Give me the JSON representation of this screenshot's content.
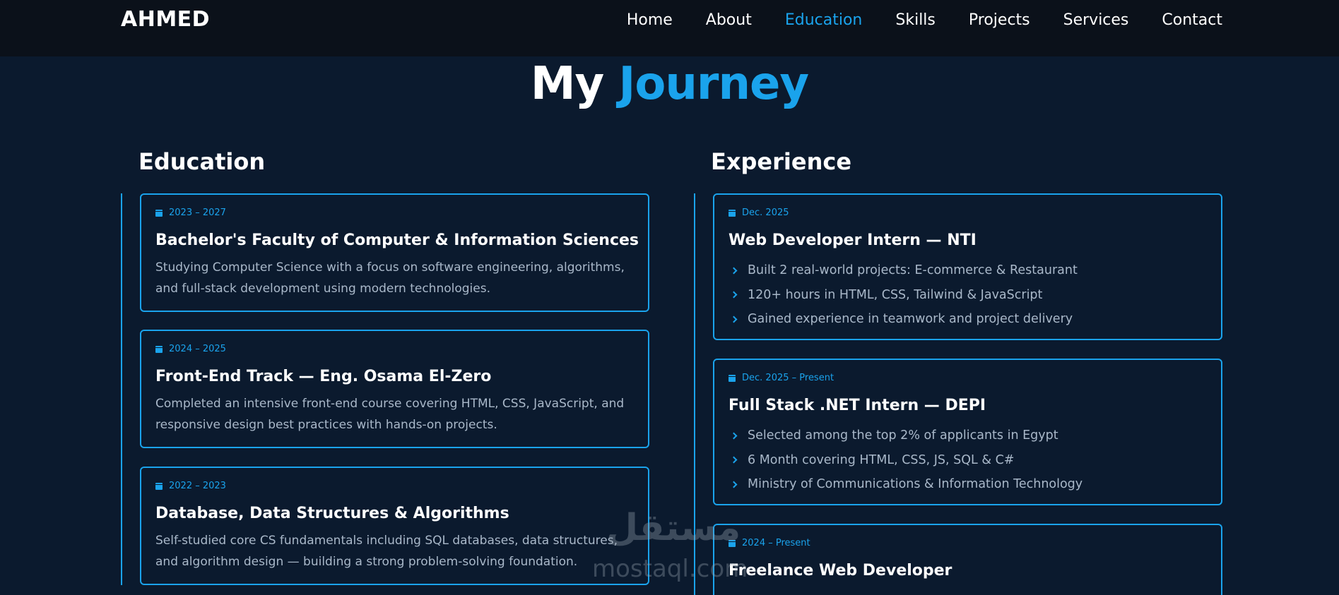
{
  "nav": {
    "brand": "AHMED",
    "links": [
      "Home",
      "About",
      "Education",
      "Skills",
      "Projects",
      "Services",
      "Contact"
    ],
    "active": "Education"
  },
  "title": {
    "part1": "My",
    "part2": "Journey"
  },
  "education": {
    "heading": "Education",
    "items": [
      {
        "date": "2023 – 2027",
        "title": "Bachelor's Faculty of Computer & Information Sciences",
        "desc": "Studying Computer Science with a focus on software engineering, algorithms, and full-stack development using modern technologies."
      },
      {
        "date": "2024 – 2025",
        "title": "Front-End Track — Eng. Osama El-Zero",
        "desc": "Completed an intensive front-end course covering HTML, CSS, JavaScript, and responsive design best practices with hands-on projects."
      },
      {
        "date": "2022 – 2023",
        "title": "Database, Data Structures & Algorithms",
        "desc": "Self-studied core CS fundamentals including SQL databases, data structures, and algorithm design — building a strong problem-solving foundation."
      }
    ]
  },
  "experience": {
    "heading": "Experience",
    "items": [
      {
        "date": "Dec. 2025",
        "title": "Web Developer Intern — NTI",
        "bullets": [
          "Built 2 real-world projects: E-commerce & Restaurant",
          "120+ hours in HTML, CSS, Tailwind & JavaScript",
          "Gained experience in teamwork and project delivery"
        ]
      },
      {
        "date": "Dec. 2025 – Present",
        "title": "Full Stack .NET Intern — DEPI",
        "bullets": [
          "Selected among the top 2% of applicants in Egypt",
          "6 Month covering HTML, CSS, JS, SQL & C#",
          "Ministry of Communications & Information Technology"
        ]
      },
      {
        "date": "2024 – Present",
        "title": "Freelance Web Developer"
      }
    ]
  },
  "watermark": {
    "arabic": "مستقل",
    "latin": "mostaql.com"
  },
  "colors": {
    "accent": "#1aa3ec",
    "background": "#0b1a2e",
    "navbar": "#0b111a"
  }
}
